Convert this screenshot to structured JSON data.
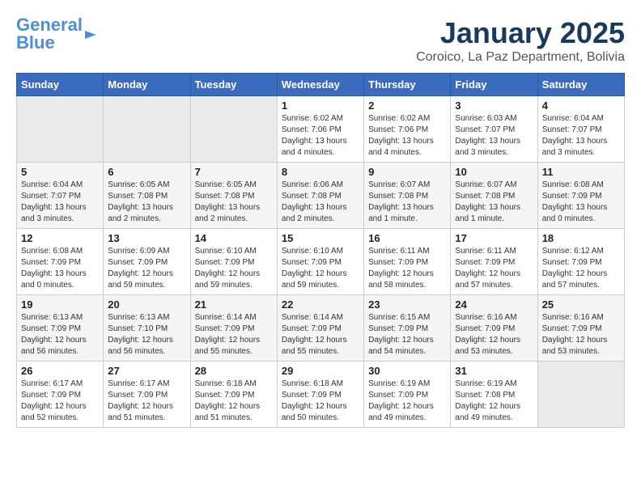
{
  "logo": {
    "line1": "General",
    "line2": "Blue"
  },
  "title": "January 2025",
  "subtitle": "Coroico, La Paz Department, Bolivia",
  "days_of_week": [
    "Sunday",
    "Monday",
    "Tuesday",
    "Wednesday",
    "Thursday",
    "Friday",
    "Saturday"
  ],
  "weeks": [
    [
      {
        "day": "",
        "empty": true
      },
      {
        "day": "",
        "empty": true
      },
      {
        "day": "",
        "empty": true
      },
      {
        "day": "1",
        "sunrise": "Sunrise: 6:02 AM",
        "sunset": "Sunset: 7:06 PM",
        "daylight": "Daylight: 13 hours and 4 minutes."
      },
      {
        "day": "2",
        "sunrise": "Sunrise: 6:02 AM",
        "sunset": "Sunset: 7:06 PM",
        "daylight": "Daylight: 13 hours and 4 minutes."
      },
      {
        "day": "3",
        "sunrise": "Sunrise: 6:03 AM",
        "sunset": "Sunset: 7:07 PM",
        "daylight": "Daylight: 13 hours and 3 minutes."
      },
      {
        "day": "4",
        "sunrise": "Sunrise: 6:04 AM",
        "sunset": "Sunset: 7:07 PM",
        "daylight": "Daylight: 13 hours and 3 minutes."
      }
    ],
    [
      {
        "day": "5",
        "sunrise": "Sunrise: 6:04 AM",
        "sunset": "Sunset: 7:07 PM",
        "daylight": "Daylight: 13 hours and 3 minutes."
      },
      {
        "day": "6",
        "sunrise": "Sunrise: 6:05 AM",
        "sunset": "Sunset: 7:08 PM",
        "daylight": "Daylight: 13 hours and 2 minutes."
      },
      {
        "day": "7",
        "sunrise": "Sunrise: 6:05 AM",
        "sunset": "Sunset: 7:08 PM",
        "daylight": "Daylight: 13 hours and 2 minutes."
      },
      {
        "day": "8",
        "sunrise": "Sunrise: 6:06 AM",
        "sunset": "Sunset: 7:08 PM",
        "daylight": "Daylight: 13 hours and 2 minutes."
      },
      {
        "day": "9",
        "sunrise": "Sunrise: 6:07 AM",
        "sunset": "Sunset: 7:08 PM",
        "daylight": "Daylight: 13 hours and 1 minute."
      },
      {
        "day": "10",
        "sunrise": "Sunrise: 6:07 AM",
        "sunset": "Sunset: 7:08 PM",
        "daylight": "Daylight: 13 hours and 1 minute."
      },
      {
        "day": "11",
        "sunrise": "Sunrise: 6:08 AM",
        "sunset": "Sunset: 7:09 PM",
        "daylight": "Daylight: 13 hours and 0 minutes."
      }
    ],
    [
      {
        "day": "12",
        "sunrise": "Sunrise: 6:08 AM",
        "sunset": "Sunset: 7:09 PM",
        "daylight": "Daylight: 13 hours and 0 minutes."
      },
      {
        "day": "13",
        "sunrise": "Sunrise: 6:09 AM",
        "sunset": "Sunset: 7:09 PM",
        "daylight": "Daylight: 12 hours and 59 minutes."
      },
      {
        "day": "14",
        "sunrise": "Sunrise: 6:10 AM",
        "sunset": "Sunset: 7:09 PM",
        "daylight": "Daylight: 12 hours and 59 minutes."
      },
      {
        "day": "15",
        "sunrise": "Sunrise: 6:10 AM",
        "sunset": "Sunset: 7:09 PM",
        "daylight": "Daylight: 12 hours and 59 minutes."
      },
      {
        "day": "16",
        "sunrise": "Sunrise: 6:11 AM",
        "sunset": "Sunset: 7:09 PM",
        "daylight": "Daylight: 12 hours and 58 minutes."
      },
      {
        "day": "17",
        "sunrise": "Sunrise: 6:11 AM",
        "sunset": "Sunset: 7:09 PM",
        "daylight": "Daylight: 12 hours and 57 minutes."
      },
      {
        "day": "18",
        "sunrise": "Sunrise: 6:12 AM",
        "sunset": "Sunset: 7:09 PM",
        "daylight": "Daylight: 12 hours and 57 minutes."
      }
    ],
    [
      {
        "day": "19",
        "sunrise": "Sunrise: 6:13 AM",
        "sunset": "Sunset: 7:09 PM",
        "daylight": "Daylight: 12 hours and 56 minutes."
      },
      {
        "day": "20",
        "sunrise": "Sunrise: 6:13 AM",
        "sunset": "Sunset: 7:10 PM",
        "daylight": "Daylight: 12 hours and 56 minutes."
      },
      {
        "day": "21",
        "sunrise": "Sunrise: 6:14 AM",
        "sunset": "Sunset: 7:09 PM",
        "daylight": "Daylight: 12 hours and 55 minutes."
      },
      {
        "day": "22",
        "sunrise": "Sunrise: 6:14 AM",
        "sunset": "Sunset: 7:09 PM",
        "daylight": "Daylight: 12 hours and 55 minutes."
      },
      {
        "day": "23",
        "sunrise": "Sunrise: 6:15 AM",
        "sunset": "Sunset: 7:09 PM",
        "daylight": "Daylight: 12 hours and 54 minutes."
      },
      {
        "day": "24",
        "sunrise": "Sunrise: 6:16 AM",
        "sunset": "Sunset: 7:09 PM",
        "daylight": "Daylight: 12 hours and 53 minutes."
      },
      {
        "day": "25",
        "sunrise": "Sunrise: 6:16 AM",
        "sunset": "Sunset: 7:09 PM",
        "daylight": "Daylight: 12 hours and 53 minutes."
      }
    ],
    [
      {
        "day": "26",
        "sunrise": "Sunrise: 6:17 AM",
        "sunset": "Sunset: 7:09 PM",
        "daylight": "Daylight: 12 hours and 52 minutes."
      },
      {
        "day": "27",
        "sunrise": "Sunrise: 6:17 AM",
        "sunset": "Sunset: 7:09 PM",
        "daylight": "Daylight: 12 hours and 51 minutes."
      },
      {
        "day": "28",
        "sunrise": "Sunrise: 6:18 AM",
        "sunset": "Sunset: 7:09 PM",
        "daylight": "Daylight: 12 hours and 51 minutes."
      },
      {
        "day": "29",
        "sunrise": "Sunrise: 6:18 AM",
        "sunset": "Sunset: 7:09 PM",
        "daylight": "Daylight: 12 hours and 50 minutes."
      },
      {
        "day": "30",
        "sunrise": "Sunrise: 6:19 AM",
        "sunset": "Sunset: 7:09 PM",
        "daylight": "Daylight: 12 hours and 49 minutes."
      },
      {
        "day": "31",
        "sunrise": "Sunrise: 6:19 AM",
        "sunset": "Sunset: 7:08 PM",
        "daylight": "Daylight: 12 hours and 49 minutes."
      },
      {
        "day": "",
        "empty": true
      }
    ]
  ]
}
